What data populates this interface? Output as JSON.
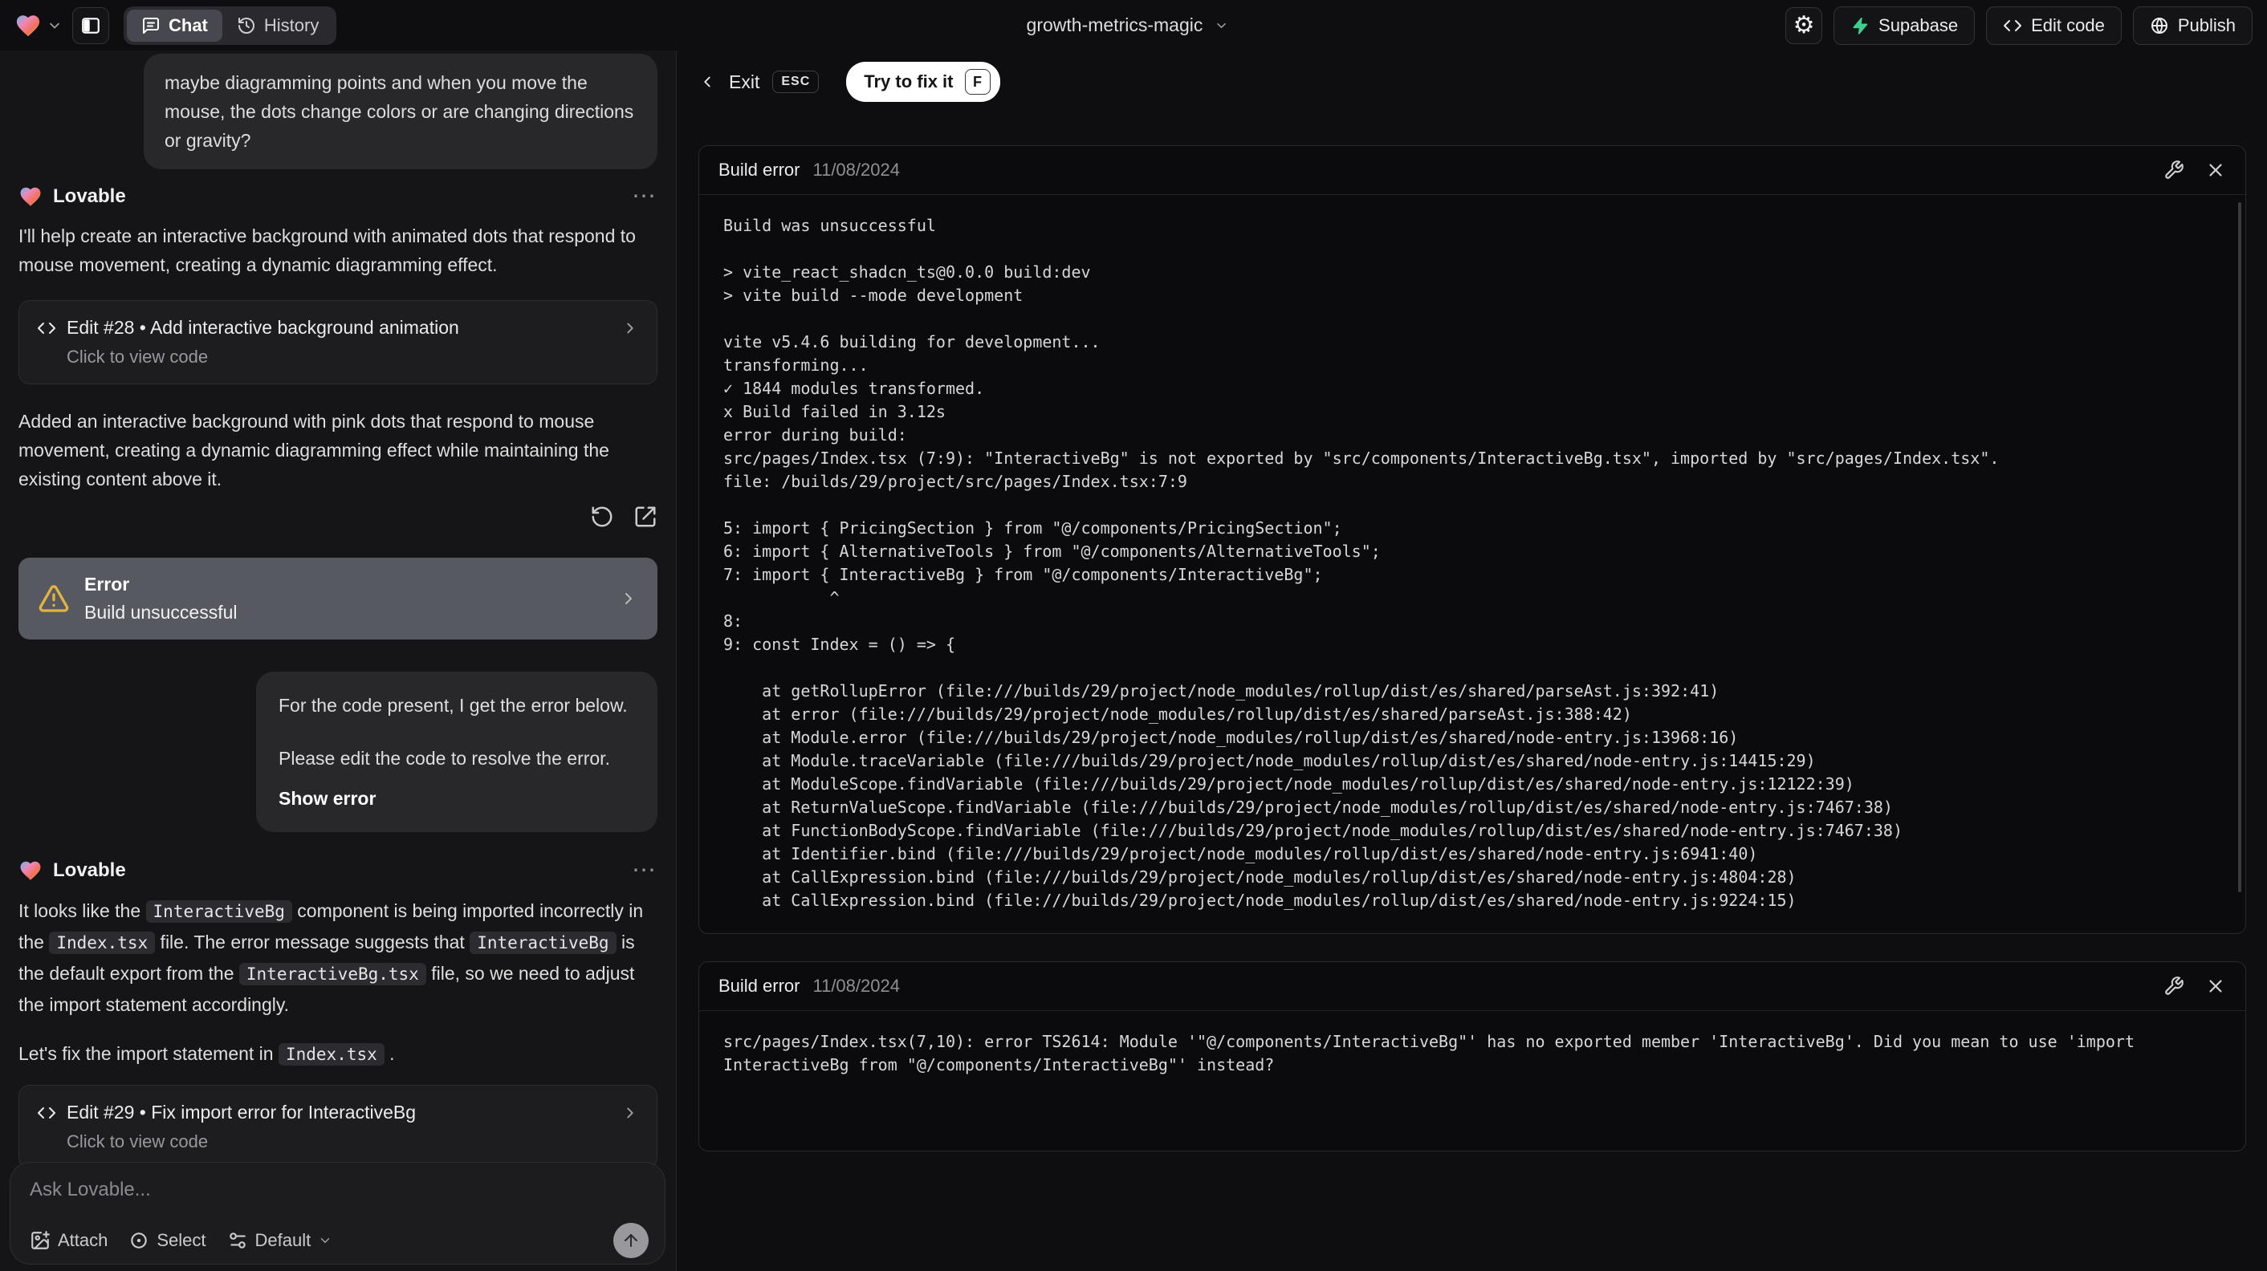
{
  "topbar": {
    "project_name": "growth-metrics-magic",
    "tab_chat": "Chat",
    "tab_history": "History",
    "btn_supabase": "Supabase",
    "btn_edit_code": "Edit code",
    "btn_publish": "Publish"
  },
  "icons": {
    "gear_glyph": "⚙",
    "more_glyph": "⋯"
  },
  "chat": {
    "assistant_name": "Lovable",
    "user_message_1": "maybe diagramming points and when you move the mouse, the dots change colors or are changing directions or gravity?",
    "assistant_message_1": "I'll help create an interactive background with animated dots that respond to mouse movement, creating a dynamic diagramming effect.",
    "edit_28": {
      "title": "Edit #28 • Add interactive background animation",
      "subtitle": "Click to view code"
    },
    "assistant_message_2": "Added an interactive background with pink dots that respond to mouse movement, creating a dynamic diagramming effect while maintaining the existing content above it.",
    "error_card": {
      "title": "Error",
      "subtitle": "Build unsuccessful"
    },
    "user_message_2_line1": "For the code present, I get the error below.",
    "user_message_2_line2": "Please edit the code to resolve the error.",
    "user_message_2_action": "Show error",
    "assistant_message_3": [
      {
        "type": "text",
        "text": "It looks like the "
      },
      {
        "type": "code",
        "text": "InteractiveBg"
      },
      {
        "type": "text",
        "text": " component is being imported incorrectly in the "
      },
      {
        "type": "code",
        "text": "Index.tsx"
      },
      {
        "type": "text",
        "text": " file. The error message suggests that "
      },
      {
        "type": "code",
        "text": "InteractiveBg"
      },
      {
        "type": "text",
        "text": " is the default export from the "
      },
      {
        "type": "code",
        "text": "InteractiveBg.tsx"
      },
      {
        "type": "text",
        "text": " file, so we need to adjust the import statement accordingly."
      }
    ],
    "assistant_message_4": [
      {
        "type": "text",
        "text": "Let's fix the import statement in "
      },
      {
        "type": "code",
        "text": "Index.tsx"
      },
      {
        "type": "text",
        "text": " ."
      }
    ],
    "edit_29": {
      "title": "Edit #29 • Fix import error for InteractiveBg",
      "subtitle": "Click to view code"
    }
  },
  "composer": {
    "placeholder": "Ask Lovable...",
    "attach_label": "Attach",
    "select_label": "Select",
    "mode_label": "Default"
  },
  "preview": {
    "exit_label": "Exit",
    "esc_key": "ESC",
    "fix_button_label": "Try to fix it",
    "fix_key": "F",
    "panels": [
      {
        "title": "Build error",
        "date": "11/08/2024",
        "log": "Build was unsuccessful\n\n> vite_react_shadcn_ts@0.0.0 build:dev\n> vite build --mode development\n\nvite v5.4.6 building for development...\ntransforming...\n✓ 1844 modules transformed.\nx Build failed in 3.12s\nerror during build:\nsrc/pages/Index.tsx (7:9): \"InteractiveBg\" is not exported by \"src/components/InteractiveBg.tsx\", imported by \"src/pages/Index.tsx\".\nfile: /builds/29/project/src/pages/Index.tsx:7:9\n\n5: import { PricingSection } from \"@/components/PricingSection\";\n6: import { AlternativeTools } from \"@/components/AlternativeTools\";\n7: import { InteractiveBg } from \"@/components/InteractiveBg\";\n           ^\n8: \n9: const Index = () => {\n\n    at getRollupError (file:///builds/29/project/node_modules/rollup/dist/es/shared/parseAst.js:392:41)\n    at error (file:///builds/29/project/node_modules/rollup/dist/es/shared/parseAst.js:388:42)\n    at Module.error (file:///builds/29/project/node_modules/rollup/dist/es/shared/node-entry.js:13968:16)\n    at Module.traceVariable (file:///builds/29/project/node_modules/rollup/dist/es/shared/node-entry.js:14415:29)\n    at ModuleScope.findVariable (file:///builds/29/project/node_modules/rollup/dist/es/shared/node-entry.js:12122:39)\n    at ReturnValueScope.findVariable (file:///builds/29/project/node_modules/rollup/dist/es/shared/node-entry.js:7467:38)\n    at FunctionBodyScope.findVariable (file:///builds/29/project/node_modules/rollup/dist/es/shared/node-entry.js:7467:38)\n    at Identifier.bind (file:///builds/29/project/node_modules/rollup/dist/es/shared/node-entry.js:6941:40)\n    at CallExpression.bind (file:///builds/29/project/node_modules/rollup/dist/es/shared/node-entry.js:4804:28)\n    at CallExpression.bind (file:///builds/29/project/node_modules/rollup/dist/es/shared/node-entry.js:9224:15)"
      },
      {
        "title": "Build error",
        "date": "11/08/2024",
        "log": "src/pages/Index.tsx(7,10): error TS2614: Module '\"@/components/InteractiveBg\"' has no exported member 'InteractiveBg'. Did you mean to use 'import InteractiveBg from \"@/components/InteractiveBg\"' instead?"
      }
    ]
  },
  "colors": {
    "supabase_green": "#3ecf8e",
    "warning_amber": "#e3b341",
    "error_card_bg": "#565960",
    "fix_button_bg": "#ffffff"
  }
}
